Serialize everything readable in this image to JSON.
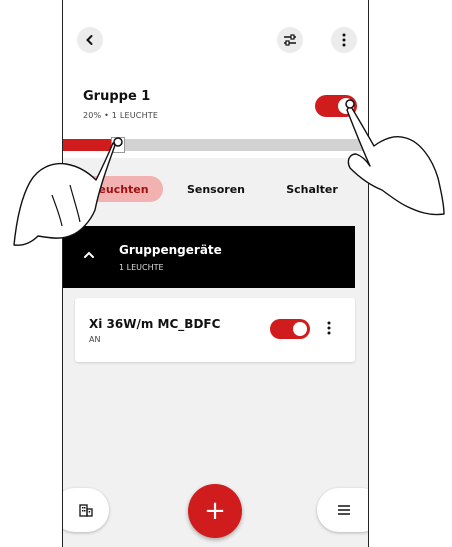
{
  "header": {
    "back_icon": "chevron-left-icon",
    "filter_icon": "sliders-icon",
    "menu_icon": "more-vertical-icon"
  },
  "group": {
    "title": "Gruppe 1",
    "subtitle": "20% • 1 LEUCHTE",
    "toggle_on": true,
    "brightness_percent": 20
  },
  "tabs": [
    {
      "label": "Leuchten",
      "active": true
    },
    {
      "label": "Sensoren",
      "active": false
    },
    {
      "label": "Schalter",
      "active": false
    }
  ],
  "section": {
    "title": "Gruppengeräte",
    "subtitle": "1 LEUCHTE",
    "icon": "chevron-up-icon"
  },
  "devices": [
    {
      "name": "Xi 36W/m MC_BDFC",
      "status": "AN",
      "toggle_on": true
    }
  ],
  "bottom_bar": {
    "left_icon": "building-icon",
    "center_icon": "plus-icon",
    "center_label": "+",
    "right_icon": "hamburger-menu-icon"
  },
  "colors": {
    "accent": "#d01c1c",
    "tab_active_bg": "#f2b2b2",
    "section_bg": "#000000"
  }
}
